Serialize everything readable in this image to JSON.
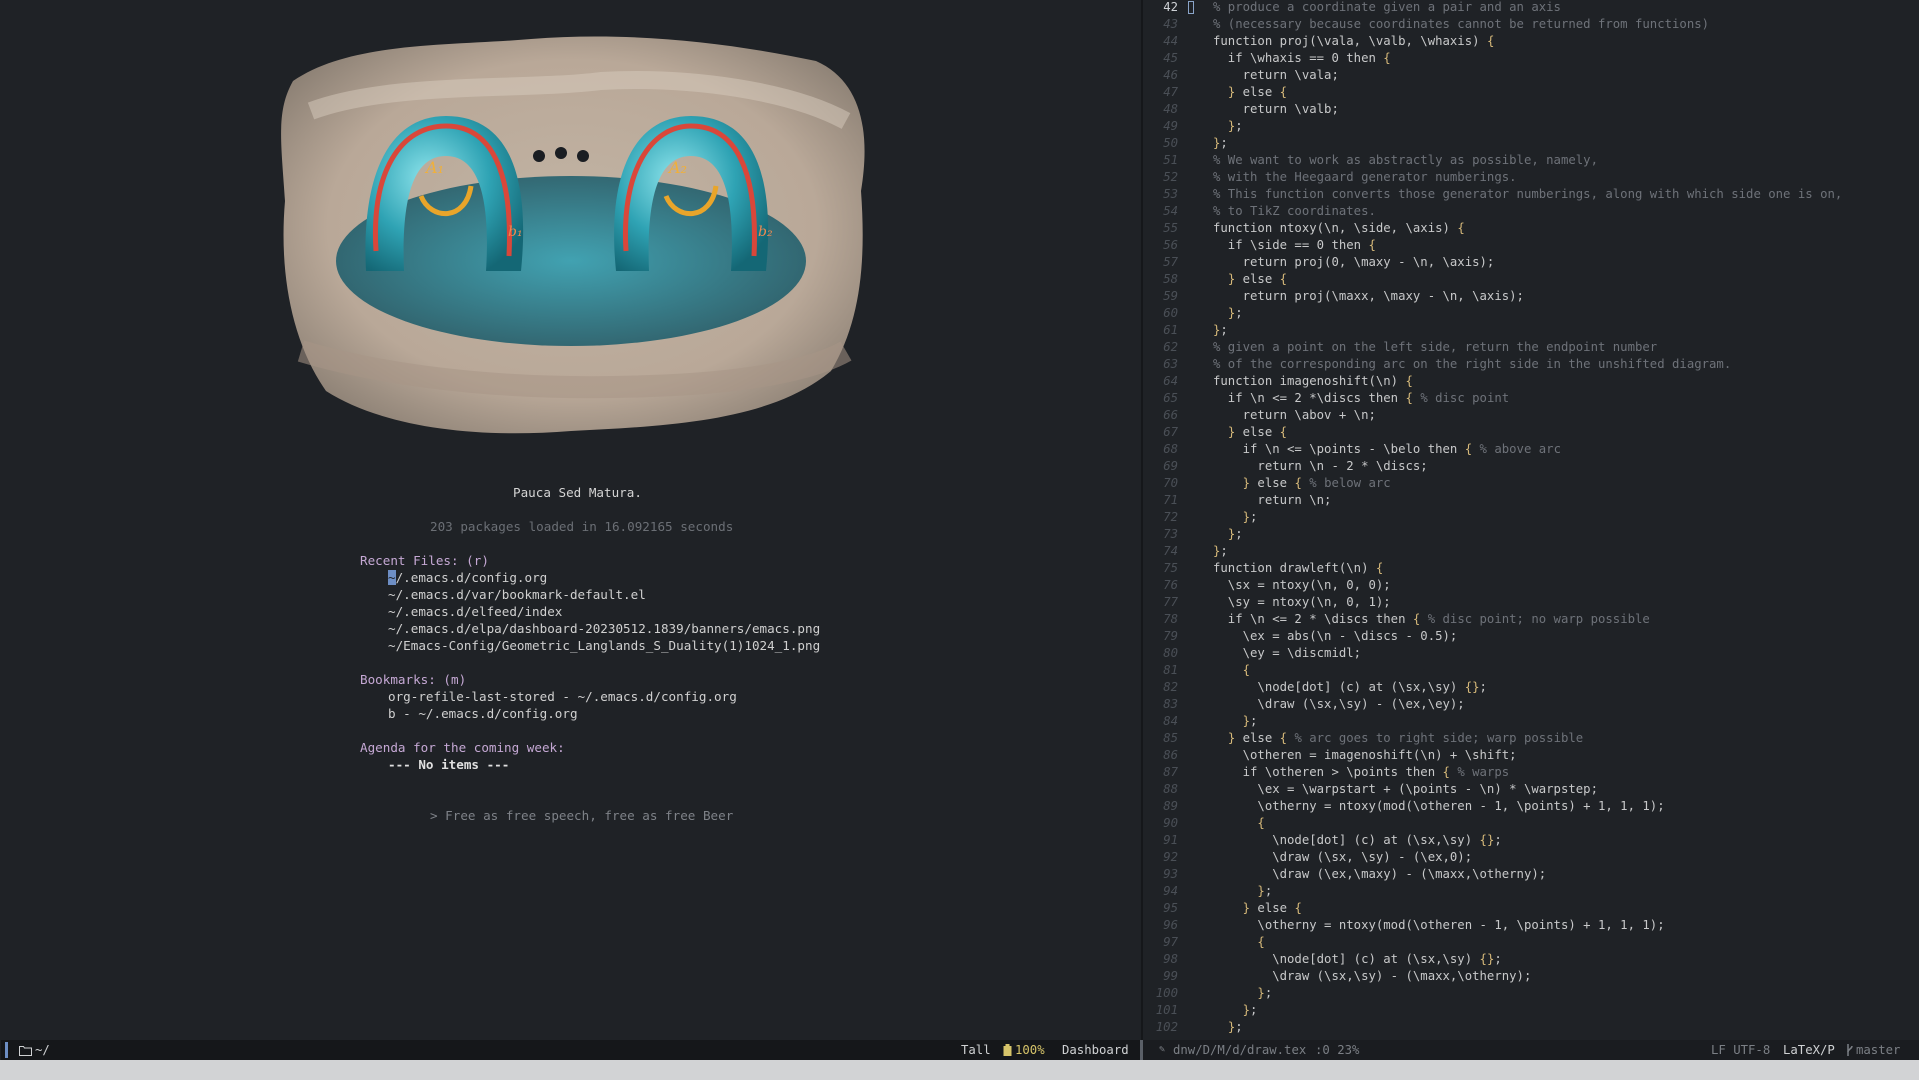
{
  "dashboard": {
    "tagline": "Pauca Sed Matura.",
    "loaded_text": "203 packages loaded in 16.092165 seconds",
    "recent_files_heading": "Recent Files: (r)",
    "recent_files": [
      "~/.emacs.d/config.org",
      "~/.emacs.d/var/bookmark-default.el",
      "~/.emacs.d/elfeed/index",
      "~/.emacs.d/elpa/dashboard-20230512.1839/banners/emacs.png",
      "~/Emacs-Config/Geometric_Langlands_S_Duality(1)1024_1.png"
    ],
    "bookmarks_heading": "Bookmarks: (m)",
    "bookmarks": [
      "org-refile-last-stored - ~/.emacs.d/config.org",
      "b - ~/.emacs.d/config.org"
    ],
    "agenda_heading": "Agenda for the coming week:",
    "agenda_empty": "--- No items ---",
    "footer": "> Free as free speech, free as free Beer",
    "banner_labels": {
      "a1": "A₁",
      "a2": "A₂",
      "b1": "b₁",
      "b2": "b₂"
    }
  },
  "editor": {
    "current_line": "42",
    "lines": [
      {
        "n": "42",
        "text": "% produce a coordinate given a pair and an axis"
      },
      {
        "n": "43",
        "text": "% (necessary because coordinates cannot be returned from functions)"
      },
      {
        "n": "44",
        "text": "function proj(\\vala, \\valb, \\whaxis) {"
      },
      {
        "n": "45",
        "text": "  if \\whaxis == 0 then {"
      },
      {
        "n": "46",
        "text": "    return \\vala;"
      },
      {
        "n": "47",
        "text": "  } else {"
      },
      {
        "n": "48",
        "text": "    return \\valb;"
      },
      {
        "n": "49",
        "text": "  };"
      },
      {
        "n": "50",
        "text": "};"
      },
      {
        "n": "51",
        "text": "% We want to work as abstractly as possible, namely,"
      },
      {
        "n": "52",
        "text": "% with the Heegaard generator numberings."
      },
      {
        "n": "53",
        "text": "% This function converts those generator numberings, along with which side one is on,"
      },
      {
        "n": "54",
        "text": "% to TikZ coordinates."
      },
      {
        "n": "55",
        "text": "function ntoxy(\\n, \\side, \\axis) {"
      },
      {
        "n": "56",
        "text": "  if \\side == 0 then {"
      },
      {
        "n": "57",
        "text": "    return proj(0, \\maxy - \\n, \\axis);"
      },
      {
        "n": "58",
        "text": "  } else {"
      },
      {
        "n": "59",
        "text": "    return proj(\\maxx, \\maxy - \\n, \\axis);"
      },
      {
        "n": "60",
        "text": "  };"
      },
      {
        "n": "61",
        "text": "};"
      },
      {
        "n": "62",
        "text": "% given a point on the left side, return the endpoint number"
      },
      {
        "n": "63",
        "text": "% of the corresponding arc on the right side in the unshifted diagram."
      },
      {
        "n": "64",
        "text": "function imagenoshift(\\n) {"
      },
      {
        "n": "65",
        "text": "  if \\n <= 2 *\\discs then { % disc point"
      },
      {
        "n": "66",
        "text": "    return \\abov + \\n;"
      },
      {
        "n": "67",
        "text": "  } else {"
      },
      {
        "n": "68",
        "text": "    if \\n <= \\points - \\belo then { % above arc"
      },
      {
        "n": "69",
        "text": "      return \\n - 2 * \\discs;"
      },
      {
        "n": "70",
        "text": "    } else { % below arc"
      },
      {
        "n": "71",
        "text": "      return \\n;"
      },
      {
        "n": "72",
        "text": "    };"
      },
      {
        "n": "73",
        "text": "  };"
      },
      {
        "n": "74",
        "text": "};"
      },
      {
        "n": "75",
        "text": "function drawleft(\\n) {"
      },
      {
        "n": "76",
        "text": "  \\sx = ntoxy(\\n, 0, 0);"
      },
      {
        "n": "77",
        "text": "  \\sy = ntoxy(\\n, 0, 1);"
      },
      {
        "n": "78",
        "text": "  if \\n <= 2 * \\discs then { % disc point; no warp possible"
      },
      {
        "n": "79",
        "text": "    \\ex = abs(\\n - \\discs - 0.5);"
      },
      {
        "n": "80",
        "text": "    \\ey = \\discmidl;"
      },
      {
        "n": "81",
        "text": "    {"
      },
      {
        "n": "82",
        "text": "      \\node[dot] (c) at (\\sx,\\sy) {};"
      },
      {
        "n": "83",
        "text": "      \\draw (\\sx,\\sy) - (\\ex,\\ey);"
      },
      {
        "n": "84",
        "text": "    };"
      },
      {
        "n": "85",
        "text": "  } else { % arc goes to right side; warp possible"
      },
      {
        "n": "86",
        "text": "    \\otheren = imagenoshift(\\n) + \\shift;"
      },
      {
        "n": "87",
        "text": "    if \\otheren > \\points then { % warps"
      },
      {
        "n": "88",
        "text": "      \\ex = \\warpstart + (\\points - \\n) * \\warpstep;"
      },
      {
        "n": "89",
        "text": "      \\otherny = ntoxy(mod(\\otheren - 1, \\points) + 1, 1, 1);"
      },
      {
        "n": "90",
        "text": "      {"
      },
      {
        "n": "91",
        "text": "        \\node[dot] (c) at (\\sx,\\sy) {};"
      },
      {
        "n": "92",
        "text": "        \\draw (\\sx, \\sy) - (\\ex,0);"
      },
      {
        "n": "93",
        "text": "        \\draw (\\ex,\\maxy) - (\\maxx,\\otherny);"
      },
      {
        "n": "94",
        "text": "      };"
      },
      {
        "n": "95",
        "text": "    } else {"
      },
      {
        "n": "96",
        "text": "      \\otherny = ntoxy(mod(\\otheren - 1, \\points) + 1, 1, 1);"
      },
      {
        "n": "97",
        "text": "      {"
      },
      {
        "n": "98",
        "text": "        \\node[dot] (c) at (\\sx,\\sy) {};"
      },
      {
        "n": "99",
        "text": "        \\draw (\\sx,\\sy) - (\\maxx,\\otherny);"
      },
      {
        "n": "100",
        "text": "      };"
      },
      {
        "n": "101",
        "text": "    };"
      },
      {
        "n": "102",
        "text": "  };"
      }
    ]
  },
  "modeline_left": {
    "path": "~/",
    "layout": "Tall",
    "battery": "100%",
    "buffer": "Dashboard"
  },
  "modeline_right": {
    "file": "dnw/D/M/d/draw.tex",
    "position": ":0 23%",
    "encoding": "LF UTF-8",
    "mode": "LaTeX/P",
    "branch": "master"
  },
  "colors": {
    "background": "#1f2226",
    "comment": "#6e7279",
    "keyword": "#d6b97a",
    "heading": "#c5a8d4",
    "battery": "#d6c46a",
    "accent": "#6d8ec4"
  },
  "icons": [
    "folder-icon",
    "battery-icon",
    "git-branch-icon",
    "vc-icon"
  ]
}
